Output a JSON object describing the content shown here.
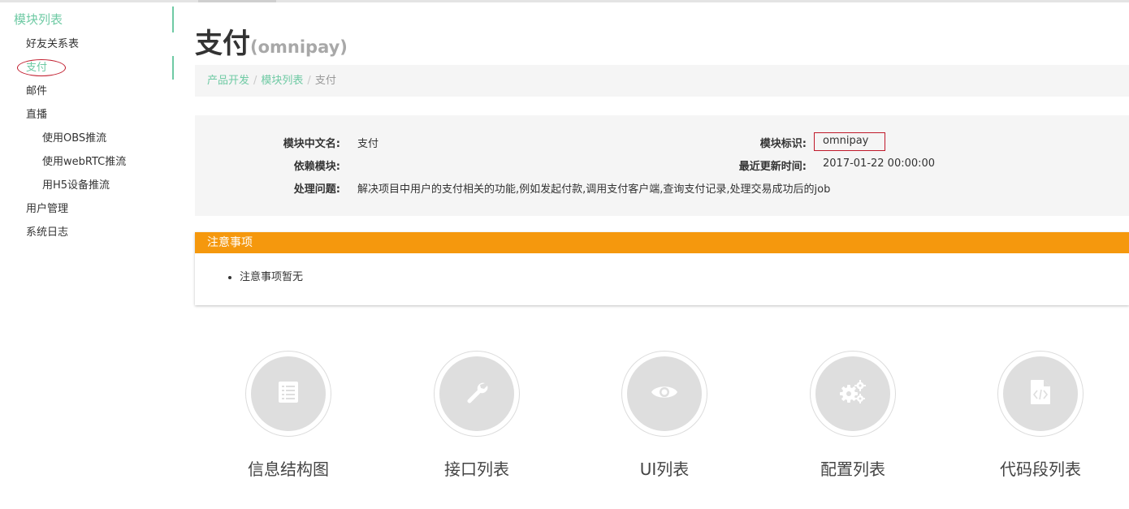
{
  "sidebar": {
    "title": "模块列表",
    "items": [
      {
        "label": "好友关系表"
      },
      {
        "label": "支付"
      },
      {
        "label": "邮件"
      },
      {
        "label": "直播"
      },
      {
        "label": "使用OBS推流"
      },
      {
        "label": "使用webRTC推流"
      },
      {
        "label": "用H5设备推流"
      },
      {
        "label": "用户管理"
      },
      {
        "label": "系统日志"
      }
    ]
  },
  "page": {
    "title": "支付",
    "subtitle": "(omnipay)"
  },
  "breadcrumb": {
    "items": [
      "产品开发",
      "模块列表",
      "支付"
    ],
    "separator": "/"
  },
  "info": {
    "name_label": "模块中文名:",
    "name_value": "支付",
    "deps_label": "依赖模块:",
    "deps_value": "",
    "issue_label": "处理问题:",
    "issue_value": "解决项目中用户的支付相关的功能,例如发起付款,调用支付客户端,查询支付记录,处理交易成功后的job",
    "id_label": "模块标识:",
    "id_value": "omnipay",
    "updated_label": "最近更新时间:",
    "updated_value": "2017-01-22 00:00:00"
  },
  "notice": {
    "title": "注意事项",
    "items": [
      "注意事项暂无"
    ]
  },
  "features": [
    {
      "label": "信息结构图",
      "icon": "list-document-icon"
    },
    {
      "label": "接口列表",
      "icon": "wrench-icon"
    },
    {
      "label": "UI列表",
      "icon": "eye-icon"
    },
    {
      "label": "配置列表",
      "icon": "gears-icon"
    },
    {
      "label": "代码段列表",
      "icon": "code-file-icon"
    }
  ],
  "colors": {
    "accent": "#6fcaa4",
    "notice_header": "#f5980d",
    "highlight_border": "#c0192a",
    "panel_bg": "#f5f5f5",
    "icon_disc": "#dedede"
  }
}
